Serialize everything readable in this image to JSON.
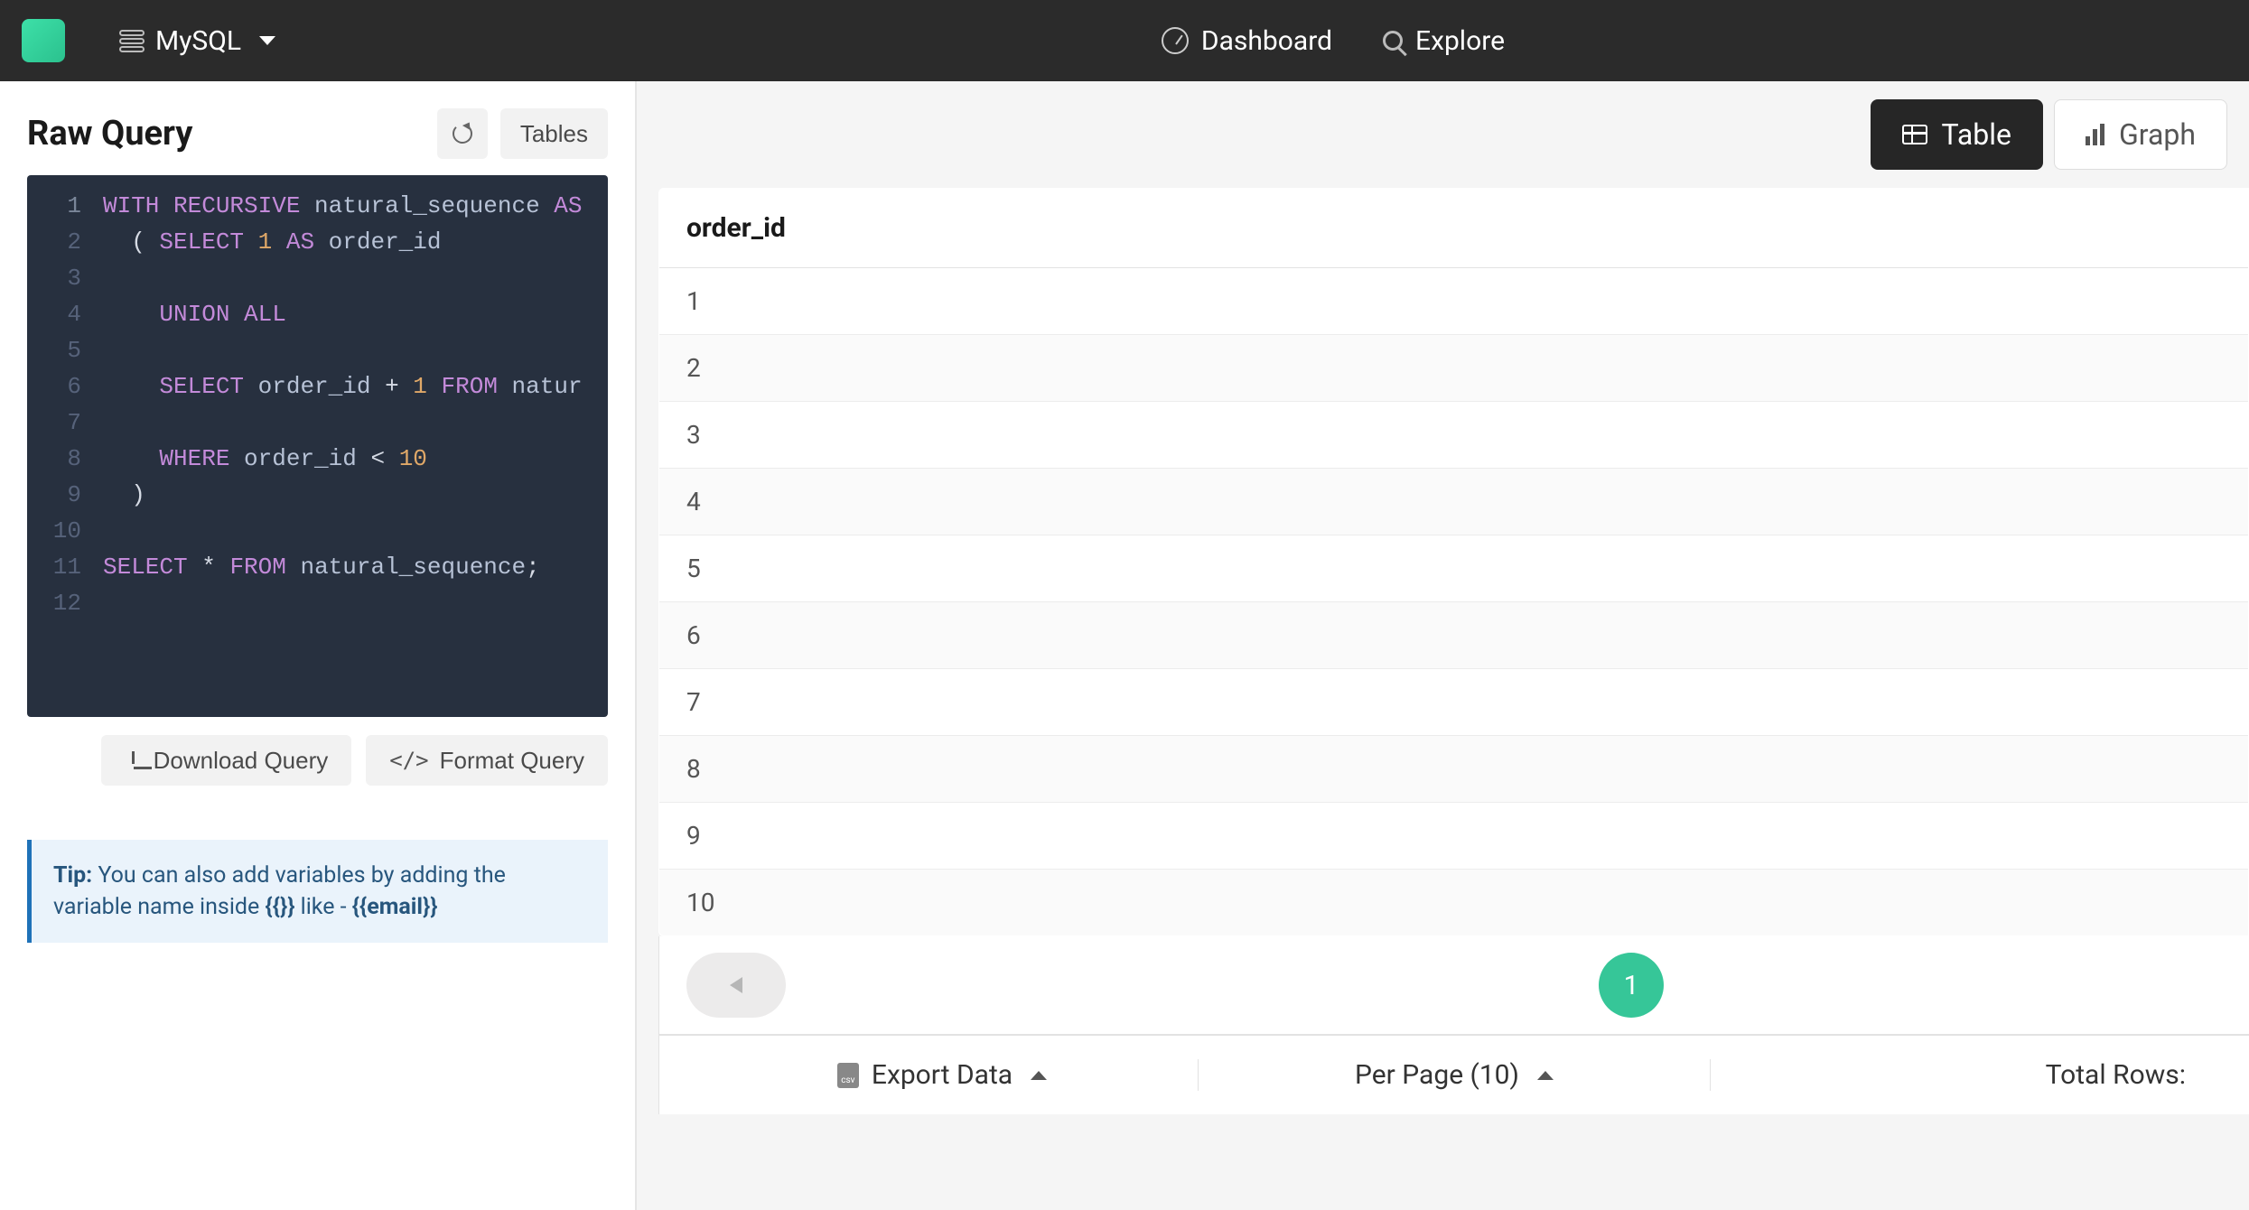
{
  "topnav": {
    "db_name": "MySQL",
    "dashboard_label": "Dashboard",
    "explore_label": "Explore"
  },
  "left": {
    "title": "Raw Query",
    "tables_btn": "Tables",
    "download_btn": "Download Query",
    "format_btn": "Format Query",
    "tip_prefix": "Tip: ",
    "tip_text": "You can also add variables by adding the variable name inside ",
    "tip_braces": "{{}}",
    "tip_like": " like - ",
    "tip_example": "{{email}}"
  },
  "code": {
    "lines": [
      {
        "n": "1",
        "tokens": [
          [
            "kw",
            "WITH"
          ],
          [
            "kw",
            " RECURSIVE"
          ],
          [
            "ident",
            " natural_sequence"
          ],
          [
            "kw",
            " AS"
          ]
        ]
      },
      {
        "n": "2",
        "tokens": [
          [
            "plain",
            "  ("
          ],
          [
            "kw",
            " SELECT"
          ],
          [
            "num",
            " 1"
          ],
          [
            "kw",
            " AS"
          ],
          [
            "ident",
            " order_id"
          ]
        ]
      },
      {
        "n": "3",
        "tokens": []
      },
      {
        "n": "4",
        "tokens": [
          [
            "plain",
            "    "
          ],
          [
            "kw",
            "UNION"
          ],
          [
            "kw",
            " ALL"
          ]
        ]
      },
      {
        "n": "5",
        "tokens": []
      },
      {
        "n": "6",
        "tokens": [
          [
            "plain",
            "    "
          ],
          [
            "kw",
            "SELECT"
          ],
          [
            "ident",
            " order_id"
          ],
          [
            "plain",
            " +"
          ],
          [
            "num",
            " 1"
          ],
          [
            "kw",
            " FROM"
          ],
          [
            "ident",
            " natur"
          ]
        ]
      },
      {
        "n": "7",
        "tokens": []
      },
      {
        "n": "8",
        "tokens": [
          [
            "plain",
            "    "
          ],
          [
            "kw",
            "WHERE"
          ],
          [
            "ident",
            " order_id"
          ],
          [
            "plain",
            " <"
          ],
          [
            "num",
            " 10"
          ]
        ]
      },
      {
        "n": "9",
        "tokens": [
          [
            "plain",
            "  )"
          ]
        ]
      },
      {
        "n": "10",
        "tokens": []
      },
      {
        "n": "11",
        "tokens": [
          [
            "kw",
            "SELECT"
          ],
          [
            "plain",
            " *"
          ],
          [
            "kw",
            " FROM"
          ],
          [
            "ident",
            " natural_sequence"
          ],
          [
            "plain",
            ";"
          ]
        ]
      },
      {
        "n": "12",
        "tokens": []
      }
    ]
  },
  "right": {
    "table_label": "Table",
    "graph_label": "Graph",
    "column_header": "order_id",
    "rows": [
      "1",
      "2",
      "3",
      "4",
      "5",
      "6",
      "7",
      "8",
      "9",
      "10"
    ],
    "page_current": "1",
    "export_label": "Export Data",
    "per_page_label": "Per Page (10)",
    "total_rows_label": "Total Rows:"
  }
}
